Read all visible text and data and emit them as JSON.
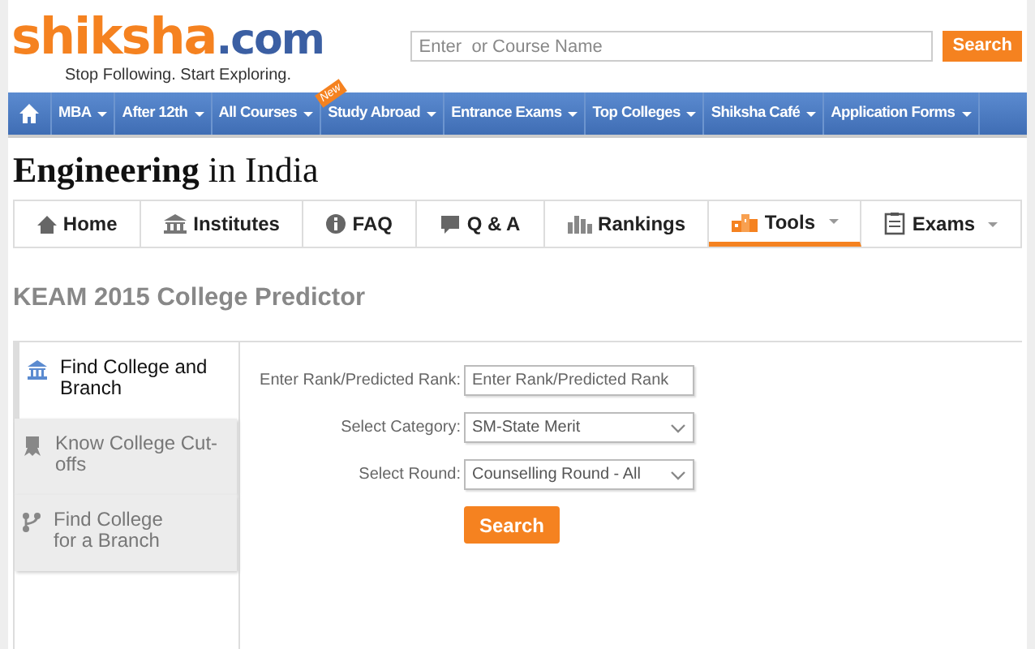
{
  "logo": {
    "brand": "shiksha",
    "domain": ".com",
    "tagline": "Stop Following. Start Exploring."
  },
  "search": {
    "placeholder": "Enter  or Course Name",
    "button": "Search"
  },
  "nav": [
    {
      "kind": "home"
    },
    {
      "kind": "menu",
      "label": "MBA"
    },
    {
      "kind": "menu",
      "label": "After 12th"
    },
    {
      "kind": "menu",
      "label": "All Courses"
    },
    {
      "kind": "menu",
      "label": "Study Abroad",
      "badge": "New"
    },
    {
      "kind": "menu",
      "label": "Entrance Exams"
    },
    {
      "kind": "menu",
      "label": "Top Colleges"
    },
    {
      "kind": "menu",
      "label": "Shiksha Café"
    },
    {
      "kind": "menu",
      "label": "Application Forms"
    }
  ],
  "page_title": "**Engineering** in India",
  "tabs": [
    {
      "label": "Home",
      "selected": false,
      "dropdown": false
    },
    {
      "label": "Institutes",
      "selected": false,
      "dropdown": false
    },
    {
      "label": "FAQ",
      "selected": false,
      "dropdown": false
    },
    {
      "label": "Q & A",
      "selected": false,
      "dropdown": false
    },
    {
      "label": "Rankings",
      "selected": false,
      "dropdown": false
    },
    {
      "label": "Tools",
      "selected": true,
      "dropdown": true
    },
    {
      "label": "Exams",
      "selected": false,
      "dropdown": true
    }
  ],
  "heading": "KEAM 2015 College Predictor",
  "side_tabs": [
    {
      "label": "Find College and\nBranch",
      "selected": true
    },
    {
      "label": "Know College Cut-\noffs",
      "selected": false
    },
    {
      "label": "Find College\nfor a Branch",
      "selected": false
    }
  ],
  "form": {
    "fields": [
      {
        "kind": "text",
        "label": "Enter Rank/Predicted Rank:",
        "placeholder": "Enter Rank/Predicted Rank"
      },
      {
        "kind": "select",
        "label": "Select Category:",
        "value": "SM-State Merit"
      },
      {
        "kind": "select",
        "label": "Select Round:",
        "value": "Counselling Round - All"
      }
    ],
    "button": "Search"
  }
}
